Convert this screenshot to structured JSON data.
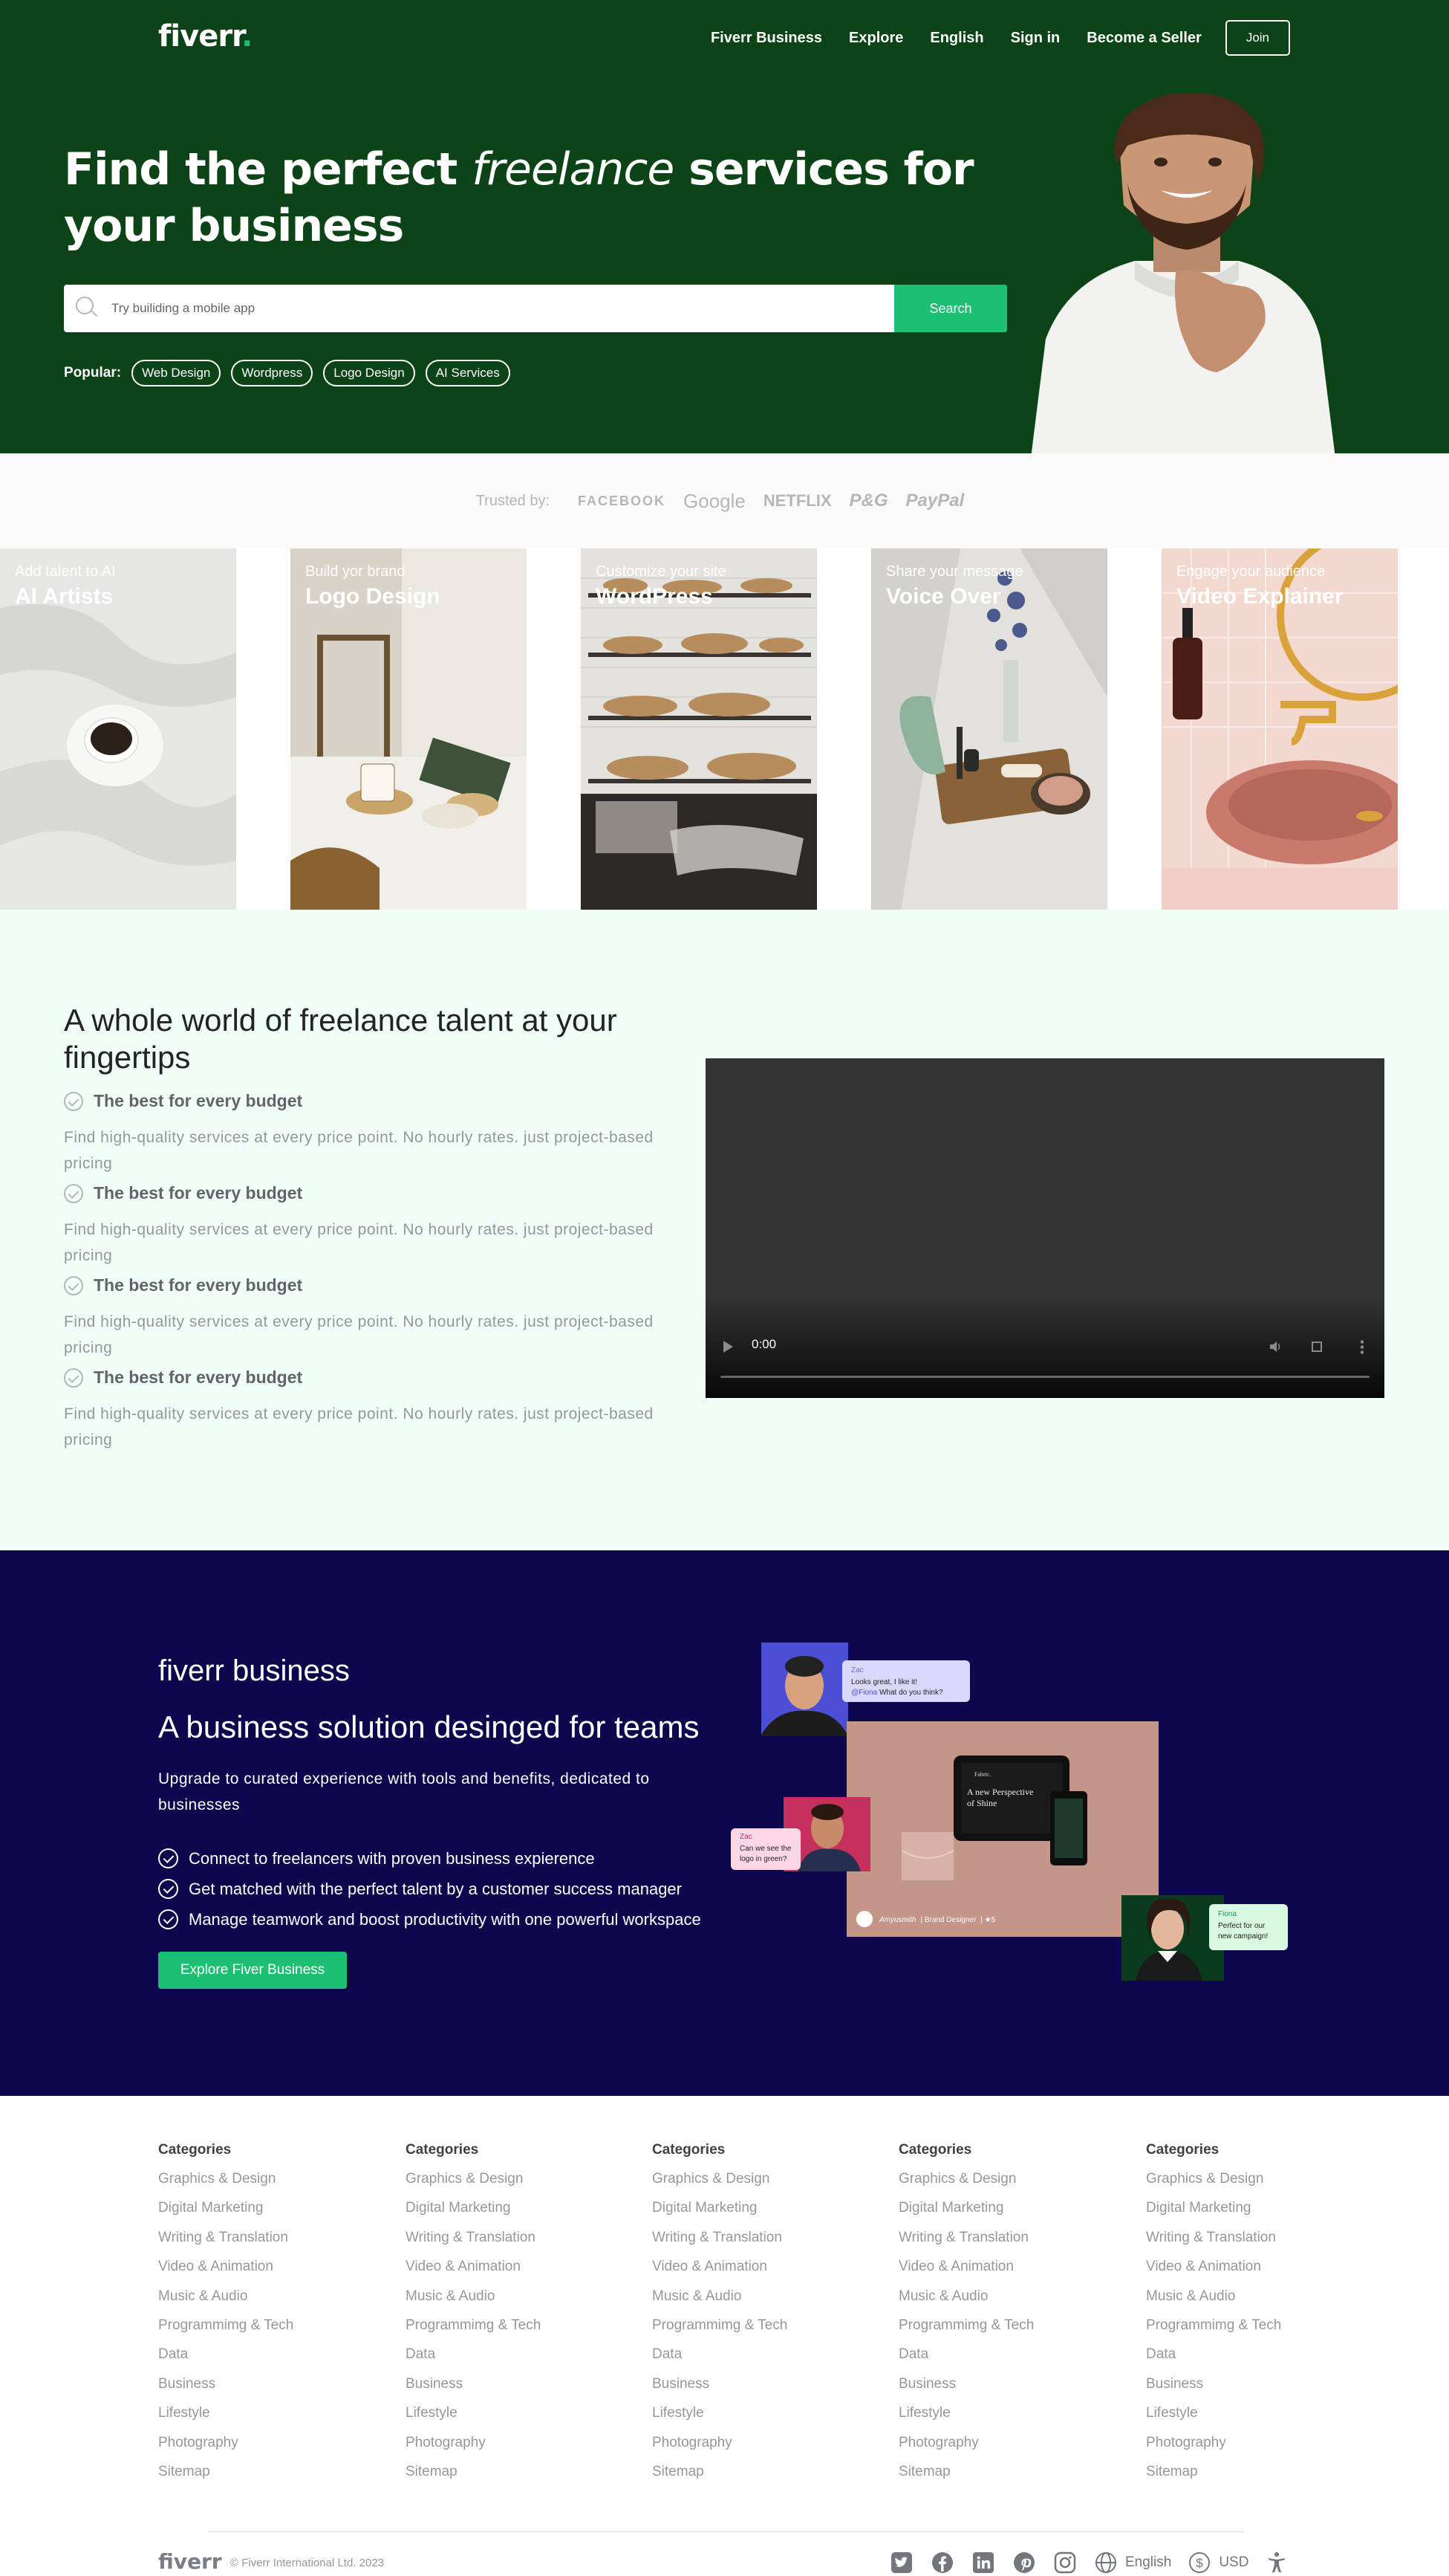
{
  "header": {
    "logo": "fiverr",
    "logo_dot": ".",
    "nav": [
      "Fiverr Business",
      "Explore",
      "English",
      "Sign in",
      "Become a Seller"
    ],
    "join_label": "Join"
  },
  "hero": {
    "title_start": "Find the perfect ",
    "title_em": "freelance",
    "title_end": " services for your business",
    "search_placeholder": "Try builiding a mobile app",
    "search_button": "Search",
    "popular_label": "Popular:",
    "popular": [
      "Web Design",
      "Wordpress",
      "Logo Design",
      "AI Services"
    ]
  },
  "trusted": {
    "label": "Trusted by:",
    "brands": [
      "FACEBOOK",
      "Google",
      "NETFLIX",
      "P&G",
      "PayPal"
    ]
  },
  "carousel": {
    "cards": [
      {
        "sub": "Add talent to AI",
        "title": "AI Artists"
      },
      {
        "sub": "Build yor brand",
        "title": "Logo Design"
      },
      {
        "sub": "Customize your site",
        "title": "WordPress"
      },
      {
        "sub": "Share your message",
        "title": "Voice Over"
      },
      {
        "sub": "Engage your audience",
        "title": "Video Explainer"
      }
    ]
  },
  "talent": {
    "title": "A whole world of freelance talent at your fingertips",
    "features": [
      {
        "title": "The best for every budget",
        "desc": "Find high-quality services at every price point. No hourly rates. just project-based pricing"
      },
      {
        "title": "The best for every budget",
        "desc": "Find high-quality services at every price point. No hourly rates. just project-based pricing"
      },
      {
        "title": "The best for every budget",
        "desc": "Find high-quality services at every price point. No hourly rates. just project-based pricing"
      },
      {
        "title": "The best for every budget",
        "desc": "Find high-quality services at every price point. No hourly rates. just project-based pricing"
      }
    ],
    "video_time": "0:00"
  },
  "business": {
    "brand": "fiverr business",
    "title": "A business solution desinged for teams",
    "desc": "Upgrade to curated experience with tools and benefits, dedicated to businesses",
    "items": [
      "Connect to freelancers with proven business expierence",
      "Get matched with the perfect talent by a customer success manager",
      "Manage teamwork and boost productivity with one powerful workspace"
    ],
    "button": "Explore Fiver Business",
    "chat1_name": "Zac",
    "chat1_line1": "Looks great, I like it!",
    "chat1_mention": "@Fiona",
    "chat1_line2": " What do you think?",
    "chat2_name": "Zac",
    "chat2_text1": "Can we see the",
    "chat2_text2": "logo in green?",
    "chat3_name": "Fiona",
    "chat3_text1": "Perfect for our",
    "chat3_text2": "new campaign!",
    "screen_title1": "A new Perspective",
    "screen_title2": "of Shine",
    "screen_brand": "Fabric.",
    "designer": "Amyusmith",
    "designer_role": "Brand Designer",
    "designer_rating": "★5"
  },
  "footer": {
    "columns": [
      {
        "heading": "Categories",
        "items": [
          "Graphics & Design",
          "Digital Marketing",
          "Writing & Translation",
          "Video & Animation",
          "Music & Audio",
          "Programmimg & Tech",
          "Data",
          "Business",
          "Lifestyle",
          "Photography",
          "Sitemap"
        ]
      },
      {
        "heading": "Categories",
        "items": [
          "Graphics & Design",
          "Digital Marketing",
          "Writing & Translation",
          "Video & Animation",
          "Music & Audio",
          "Programmimg & Tech",
          "Data",
          "Business",
          "Lifestyle",
          "Photography",
          "Sitemap"
        ]
      },
      {
        "heading": "Categories",
        "items": [
          "Graphics & Design",
          "Digital Marketing",
          "Writing & Translation",
          "Video & Animation",
          "Music & Audio",
          "Programmimg & Tech",
          "Data",
          "Business",
          "Lifestyle",
          "Photography",
          "Sitemap"
        ]
      },
      {
        "heading": "Categories",
        "items": [
          "Graphics & Design",
          "Digital Marketing",
          "Writing & Translation",
          "Video & Animation",
          "Music & Audio",
          "Programmimg & Tech",
          "Data",
          "Business",
          "Lifestyle",
          "Photography",
          "Sitemap"
        ]
      },
      {
        "heading": "Categories",
        "items": [
          "Graphics & Design",
          "Digital Marketing",
          "Writing & Translation",
          "Video & Animation",
          "Music & Audio",
          "Programmimg & Tech",
          "Data",
          "Business",
          "Lifestyle",
          "Photography",
          "Sitemap"
        ]
      }
    ],
    "logo": "fiverr",
    "copyright": "© Fiverr International Ltd. 2023",
    "language": "English",
    "currency": "USD",
    "social_icons": [
      "twitter-icon",
      "facebook-icon",
      "linkedin-icon",
      "pinterest-icon",
      "instagram-icon"
    ]
  },
  "colors": {
    "hero_bg": "#0c4417",
    "accent": "#1dbf73",
    "talent_bg": "#f1fdf7",
    "business_bg": "#0d084d"
  }
}
